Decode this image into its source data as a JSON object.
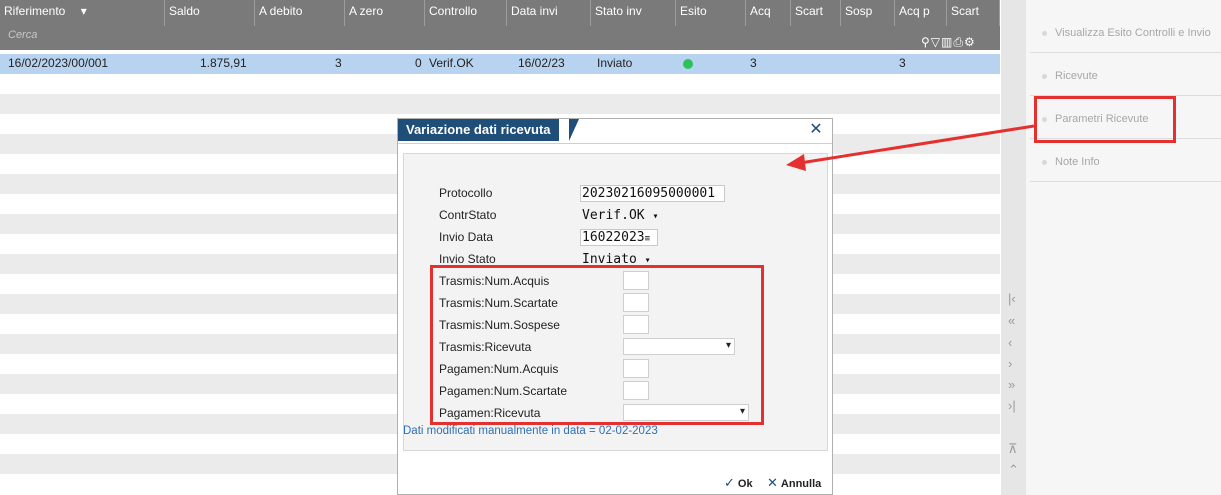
{
  "grid": {
    "headers": [
      {
        "label": "Riferimento"
      },
      {
        "label": "Saldo"
      },
      {
        "label": "A debito"
      },
      {
        "label": "A zero"
      },
      {
        "label": "Controllo"
      },
      {
        "label": "Data invi"
      },
      {
        "label": "Stato inv"
      },
      {
        "label": "Esito"
      },
      {
        "label": "Acq"
      },
      {
        "label": "Scart"
      },
      {
        "label": "Sosp"
      },
      {
        "label": "Acq p"
      },
      {
        "label": "Scart"
      }
    ],
    "search_placeholder": "Cerca",
    "row": {
      "riferimento": "16/02/2023/00/001",
      "saldo": "1.875,91",
      "a_debito": "3",
      "a_zero": "0",
      "controllo": "Verif.OK",
      "data_invio": "16/02/23",
      "stato_invio": "Inviato",
      "esito_color": "#2ec05a",
      "acq": "3",
      "acq_p": "3"
    }
  },
  "right_panel": {
    "buttons": [
      {
        "label": "Visualizza Esito Controlli e Invio"
      },
      {
        "label": "Ricevute"
      },
      {
        "label": "Parametri Ricevute"
      },
      {
        "label": "Note Info"
      }
    ]
  },
  "dialog": {
    "title": "Variazione dati ricevuta",
    "fields": {
      "protocollo_label": "Protocollo",
      "protocollo_value": "20230216095000001",
      "contrstato_label": "ContrStato",
      "contrstato_value": "Verif.OK",
      "invio_data_label": "Invio Data",
      "invio_data_value": "16022023",
      "invio_stato_label": "Invio Stato",
      "invio_stato_value": "Inviato",
      "trasmis_num_acquis": "Trasmis:Num.Acquis",
      "trasmis_num_scartate": "Trasmis:Num.Scartate",
      "trasmis_num_sospese": "Trasmis:Num.Sospese",
      "trasmis_ricevuta": "Trasmis:Ricevuta",
      "pagamen_num_acquis": "Pagamen:Num.Acquis",
      "pagamen_num_scartate": "Pagamen:Num.Scartate",
      "pagamen_ricevuta": "Pagamen:Ricevuta"
    },
    "note": "Dati modificati manualmente in data = 02-02-2023",
    "ok_label": "Ok",
    "cancel_label": "Annulla"
  },
  "annotation_color": "#e53030"
}
